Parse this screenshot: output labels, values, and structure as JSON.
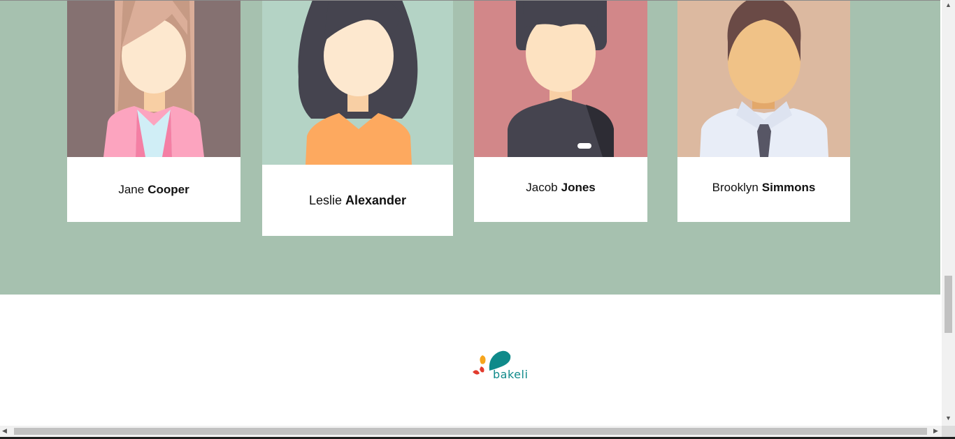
{
  "team": {
    "background_color": "#a6c1af",
    "members": [
      {
        "first_name": "Jane",
        "last_name": "Cooper",
        "avatar": "woman-long-light-hair-pink-blazer-icon",
        "photo_bg": "#857171"
      },
      {
        "first_name": "Leslie",
        "last_name": "Alexander",
        "avatar": "woman-dark-hair-orange-top-icon",
        "photo_bg": "#b4d3c5"
      },
      {
        "first_name": "Jacob",
        "last_name": "Jones",
        "avatar": "man-dark-hair-black-shirt-icon",
        "photo_bg": "#d28789"
      },
      {
        "first_name": "Brooklyn",
        "last_name": "Simmons",
        "avatar": "man-brown-hair-shirt-tie-icon",
        "photo_bg": "#dcb9a0"
      }
    ]
  },
  "footer": {
    "logo_text": "bakeli",
    "logo_icon": "bakeli-drops-logo-icon",
    "brand_color": "#0f8a8a"
  },
  "scrollbars": {
    "up_arrow": "▲",
    "down_arrow": "▼",
    "left_arrow": "◀",
    "right_arrow": "▶"
  }
}
